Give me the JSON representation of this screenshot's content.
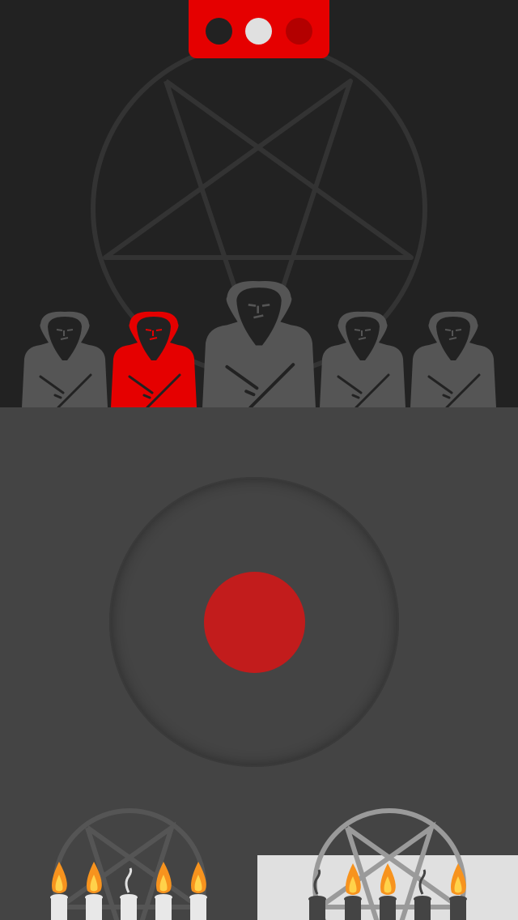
{
  "indicator": {
    "dots": [
      {
        "name": "dot-1",
        "state": "dark"
      },
      {
        "name": "dot-2",
        "state": "selected"
      },
      {
        "name": "dot-3",
        "state": "red"
      }
    ]
  },
  "colors": {
    "background_top": "#222222",
    "background_bottom": "#444444",
    "accent_red": "#e50000",
    "button_red": "#c21c1c",
    "figure_gray": "#555555",
    "light_panel": "#e0e0e0",
    "flame_orange": "#f7931e"
  },
  "cultists": [
    {
      "name": "cultist-1",
      "highlighted": false
    },
    {
      "name": "cultist-2",
      "highlighted": true
    },
    {
      "name": "cultist-3",
      "highlighted": false
    },
    {
      "name": "cultist-4",
      "highlighted": false
    },
    {
      "name": "cultist-5",
      "highlighted": false
    }
  ],
  "candles_left": [
    {
      "lit": true
    },
    {
      "lit": true
    },
    {
      "lit": false
    },
    {
      "lit": true
    },
    {
      "lit": true
    }
  ],
  "candles_right": [
    {
      "lit": false
    },
    {
      "lit": true
    },
    {
      "lit": true
    },
    {
      "lit": false
    },
    {
      "lit": true
    }
  ]
}
